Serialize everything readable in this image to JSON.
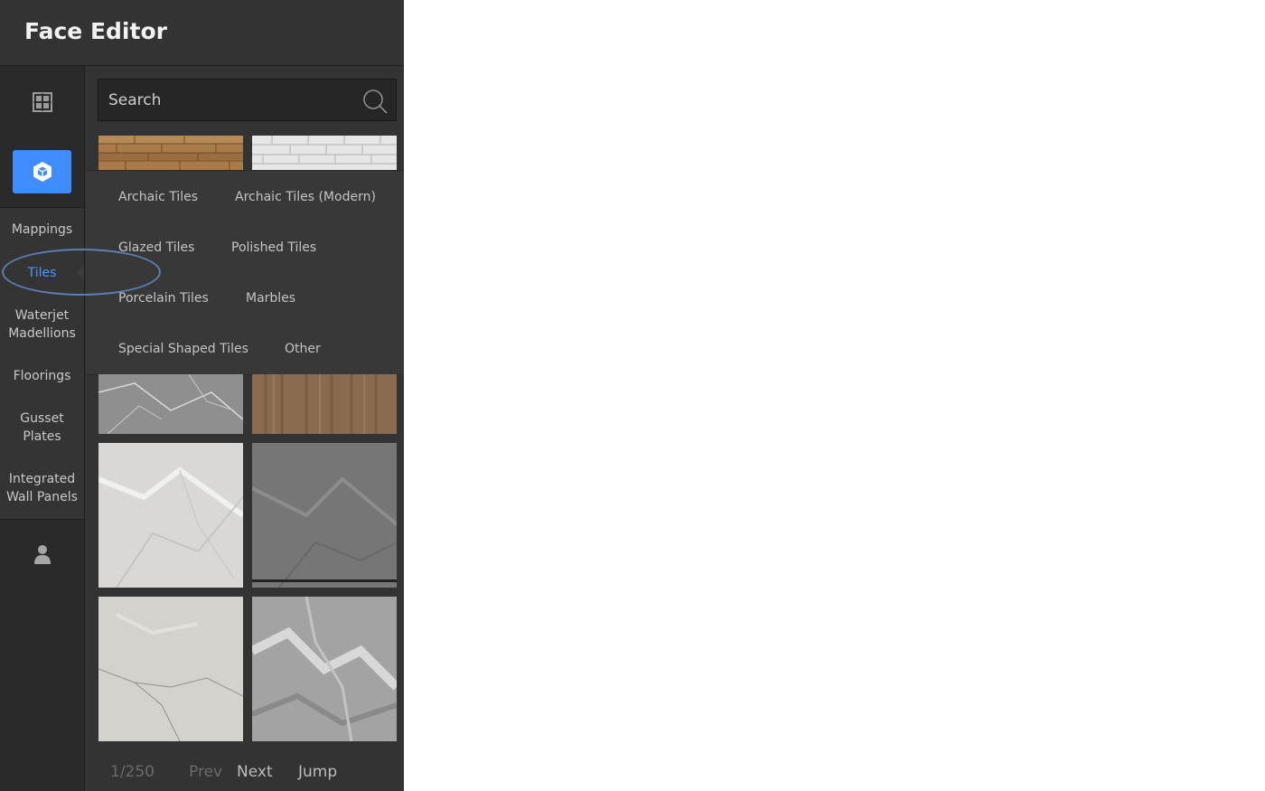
{
  "header": {
    "title": "Face Editor"
  },
  "rail": {
    "items": [
      {
        "label": "Mappings"
      },
      {
        "label": "Tiles"
      },
      {
        "label": "Waterjet Madellions"
      },
      {
        "label": "Floorings"
      },
      {
        "label": "Gusset Plates"
      },
      {
        "label": "Integrated Wall Panels"
      }
    ],
    "selected_index": 1,
    "icons": [
      "layout-icon",
      "cube-icon",
      "user-icon"
    ]
  },
  "search": {
    "placeholder": "Search"
  },
  "categories": [
    "Archaic Tiles",
    "Archaic Tiles (Modern)",
    "Glazed Tiles",
    "Polished Tiles",
    "Porcelain Tiles",
    "Marbles",
    "Special Shaped Tiles",
    "Other"
  ],
  "pagination": {
    "page": "1/250",
    "prev": "Prev",
    "next": "Next",
    "jump": "Jump"
  },
  "colors": {
    "accent": "#3f8cff",
    "panel": "#333333",
    "rail": "#2a2a2a",
    "selected_text": "#4f96ff"
  }
}
